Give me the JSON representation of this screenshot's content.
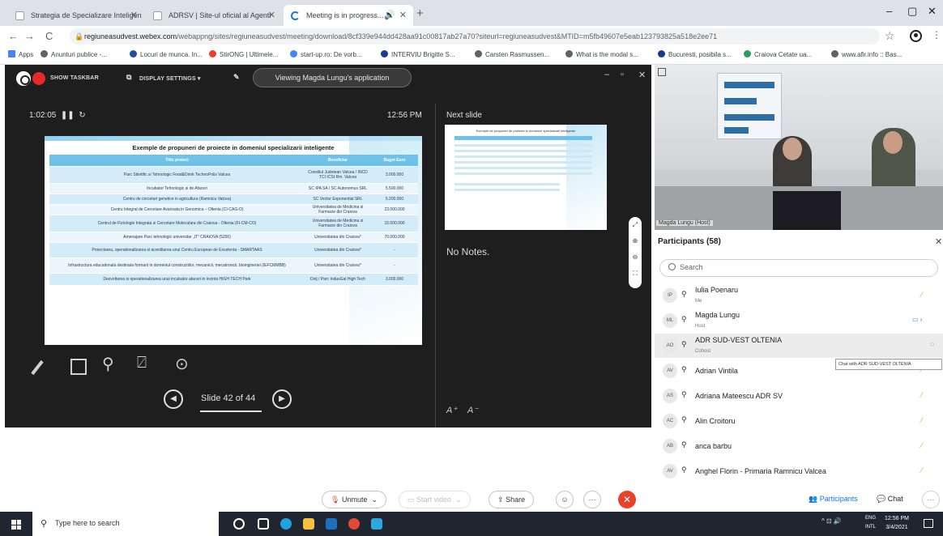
{
  "browser": {
    "tabs": [
      {
        "label": "Strategia de Specializare Inteligen"
      },
      {
        "label": "ADRSV | Site-ul oficial al Agenti"
      },
      {
        "label": "Meeting is in progress..."
      }
    ],
    "url_host": "regiuneasudvest.webex.com",
    "url_path": "/webappng/sites/regiuneasudvest/meeting/download/8cf339e944dd428aa91c00817ab27a70?siteurl=regiuneasudvest&MTID=m5fb49607e5eab123793825a518e2ee71",
    "bookmarks": [
      "Apps",
      "Anunturi publice -...",
      "Locuri de munca. In...",
      "StirONG | Ultimele...",
      "start-up.ro: De vorb...",
      "INTERVIU Brigitte S...",
      "Carsten Rasmussen...",
      "What is the modal s...",
      "Bucuresti, posibila s...",
      "Craiova Cetate ua...",
      "www.afir.info :: Bas..."
    ]
  },
  "webex": {
    "show_taskbar": "SHOW TASKBAR",
    "display_settings": "DISPLAY SETTINGS ▾",
    "viewing": "Viewing Magda Lungu's application",
    "timer": "1:02:05",
    "clock": "12:56 PM",
    "next_slide_label": "Next slide",
    "notes": "No Notes.",
    "slide_counter": "Slide 42 of 44",
    "font_small": "A⁺",
    "font_large": "A⁻"
  },
  "slide": {
    "title": "Exemple de propuneri de proiecte in domeniul specializarii inteligente",
    "headers": [
      "Titlu proiect",
      "Beneficiar",
      "Buget Euro"
    ],
    "rows": [
      [
        "Parc Stiintific si Tehnologic Food&Drink TechnoPolis Valcea",
        "Consiliul Judetean Valcea / INCD TCI ICSI Rm. Valcea",
        "3.000.000"
      ],
      [
        "Incubator Tehnologic si de Afaceri",
        "SC IPA SA / SC Autonomus SRL",
        "5.500.000"
      ],
      [
        "Centru de cercetari genetice in agricultura (Ramnicu Valcea)",
        "SC Vector Exponential SRL",
        "5.200.000"
      ],
      [
        "Centru Integral de Cercetare Avansata in Genomica – Oltenia (CI-CAG-O)",
        "Universitatea de Medicina si Farmacie din Craiova",
        "23.000.000"
      ],
      [
        "Centrul de Fiziologie Integrata si Cercetare Moleculara din Craiova - Oltenia (FI-CM-CO)",
        "Universitatea de Medicina si Farmacie din Craiova",
        "15.000.000"
      ],
      [
        "Amenajare Parc tehnologic universitar „IT” CRAIOVA (5200)",
        "Universitatea din Craiova*",
        "70.000.000"
      ],
      [
        "Proiectarea, operationalizarea si acreditarea unui Centru European de Excelenta - SMARTAAS",
        "Universitatea din Craiova*",
        "-"
      ],
      [
        "Infrastructura educationala destinata formarii in domeniul constructiilor, mecanicii, mecatronicii, bioingineriei (IEFCMMBB)",
        "Universitatea din Craiova*",
        "-"
      ],
      [
        "Dezvoltarea si operationalizarea unui incubator afaceri in incinta HIGH TECH Park",
        "Dolj / Parc IndusGal High Tech",
        "3.000.000"
      ]
    ]
  },
  "video": {
    "name_label": "Magda Lungu (Host)"
  },
  "participants": {
    "title": "Participants (58)",
    "search_placeholder": "Search",
    "tooltip": "Chat with ADR SUD-VEST OLTENIA",
    "list": [
      {
        "initials": "IP",
        "name": "Iulia Poenaru",
        "sub": "Me"
      },
      {
        "initials": "ML",
        "name": "Magda Lungu",
        "sub": "Host"
      },
      {
        "initials": "AO",
        "name": "ADR SUD-VEST OLTENIA",
        "sub": "Cohost"
      },
      {
        "initials": "AV",
        "name": "Adrian Vintila",
        "sub": ""
      },
      {
        "initials": "AS",
        "name": "Adriana Mateescu ADR SV",
        "sub": ""
      },
      {
        "initials": "AC",
        "name": "Alin Croitoru",
        "sub": ""
      },
      {
        "initials": "AB",
        "name": "anca barbu",
        "sub": ""
      },
      {
        "initials": "AV",
        "name": "Anghel Florin - Primaria Ramnicu Valcea",
        "sub": ""
      }
    ]
  },
  "controls": {
    "unmute": "Unmute",
    "start_video": "Start video",
    "share": "Share",
    "participants": "Participants",
    "chat": "Chat"
  },
  "taskbar": {
    "search_placeholder": "Type here to search",
    "lang": "ENG",
    "lang2": "INTL",
    "time": "12:56 PM",
    "date": "3/4/2021"
  }
}
